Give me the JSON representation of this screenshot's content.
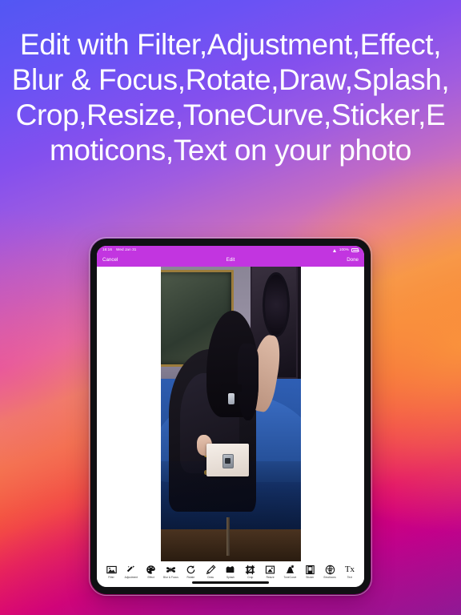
{
  "headline": "Edit with Filter,Adjustment,Effect,Blur & Focus,Rotate,Draw,Splash,Crop,Resize,ToneCurve,Sticker,Emoticons,Text on your photo",
  "background": {
    "gradient_start": "#5257f3",
    "gradient_mid_violet": "#8450ee",
    "gradient_mid_orange": "#f59a55",
    "gradient_end": "#8e1a95"
  },
  "device": {
    "type": "tablet",
    "bezel_color": "#101013",
    "screen_color": "#ffffff"
  },
  "status_bar": {
    "time": "16:16",
    "date": "Wed Jan 31",
    "wifi_icon": "wifi-icon",
    "battery_percent": "100%",
    "battery_icon": "battery-icon",
    "background": "#c235e0"
  },
  "nav_bar": {
    "cancel_label": "Cancel",
    "title": "Edit",
    "done_label": "Done",
    "background": "#c235e0"
  },
  "toolbar": {
    "tools": [
      {
        "label": "Filter",
        "icon": "photo-icon"
      },
      {
        "label": "Adjustment",
        "icon": "magic-wand-icon"
      },
      {
        "label": "Effect",
        "icon": "palette-icon"
      },
      {
        "label": "Blur & Focus",
        "icon": "butterfly-icon"
      },
      {
        "label": "Rotate",
        "icon": "rotate-icon"
      },
      {
        "label": "Draw",
        "icon": "pencil-icon"
      },
      {
        "label": "Splash",
        "icon": "splash-icon"
      },
      {
        "label": "Crop",
        "icon": "crop-icon"
      },
      {
        "label": "Resize",
        "icon": "resize-icon"
      },
      {
        "label": "ToneCurve",
        "icon": "tonecurve-icon"
      },
      {
        "label": "Sticker",
        "icon": "sticker-icon"
      },
      {
        "label": "Emoticons",
        "icon": "emoticon-icon"
      },
      {
        "label": "Text",
        "icon": "text-icon",
        "glyph": "Tx"
      }
    ]
  },
  "photo": {
    "description": "Woman in black tweed outfit seated on a blue velvet sofa with framed artwork on the wall and a white handbag"
  }
}
